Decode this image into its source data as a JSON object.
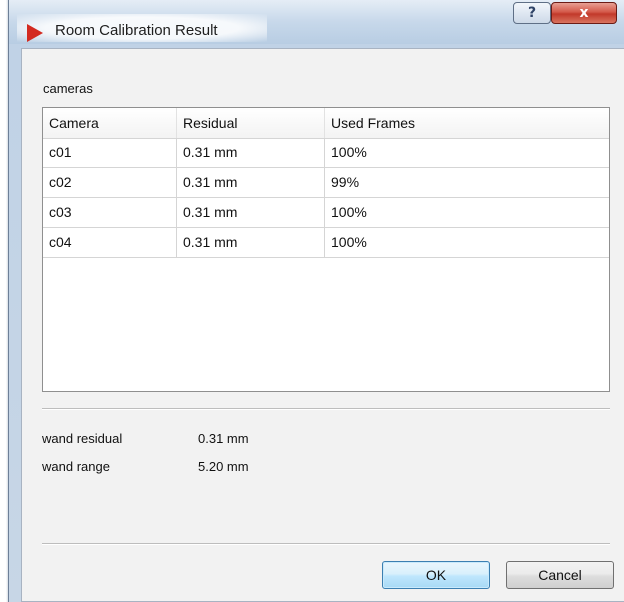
{
  "window": {
    "title": "Room Calibration Result",
    "help_label": "?",
    "close_label": "x"
  },
  "cameras": {
    "section_label": "cameras",
    "columns": [
      "Camera",
      "Residual",
      "Used Frames"
    ],
    "rows": [
      [
        "c01",
        "0.31 mm",
        "100%"
      ],
      [
        "c02",
        "0.31 mm",
        "99%"
      ],
      [
        "c03",
        "0.31 mm",
        "100%"
      ],
      [
        "c04",
        "0.31 mm",
        "100%"
      ]
    ]
  },
  "stats": {
    "wand_residual_label": "wand residual",
    "wand_residual_value": "0.31 mm",
    "wand_range_label": "wand range",
    "wand_range_value": "5.20 mm"
  },
  "buttons": {
    "ok_label": "OK",
    "cancel_label": "Cancel"
  },
  "colors": {
    "close_button": "#c2392a",
    "ok_button_border": "#3c7fb1",
    "app_icon": "#d32a20"
  }
}
